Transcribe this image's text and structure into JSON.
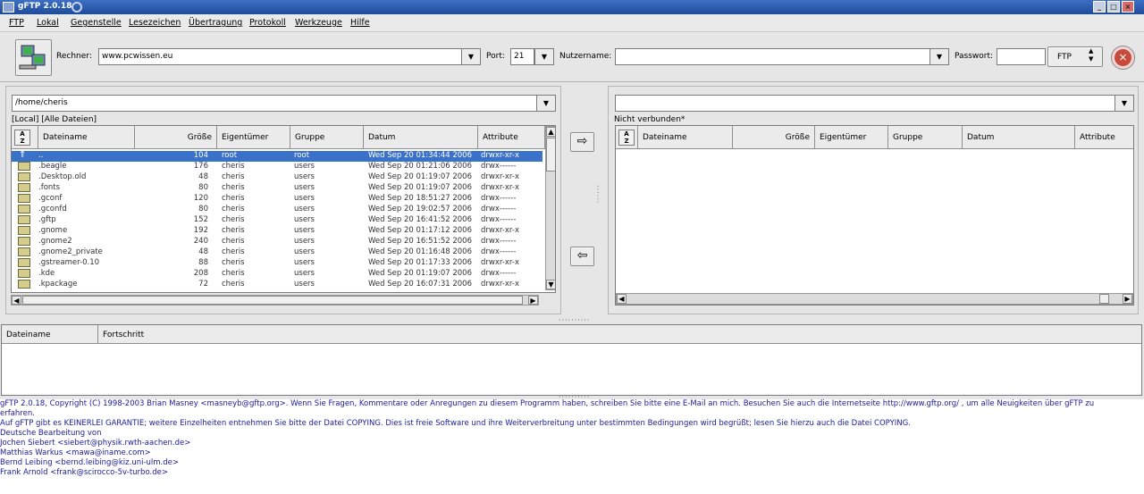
{
  "window": {
    "title": "gFTP 2.0.18"
  },
  "menu": [
    "FTP",
    "Lokal",
    "Gegenstelle",
    "Lesezeichen",
    "Übertragung",
    "Protokoll",
    "Werkzeuge",
    "Hilfe"
  ],
  "toolbar": {
    "host_label": "Rechner:",
    "host_value": "www.pcwissen.eu",
    "port_label": "Port:",
    "port_value": "21",
    "user_label": "Nutzername:",
    "user_value": "",
    "password_label": "Passwort:",
    "password_value": "",
    "protocol_value": "FTP"
  },
  "local": {
    "path": "/home/cheris",
    "status": "[Local] [Alle Dateien]",
    "columns": [
      "Dateiname",
      "Größe",
      "Eigentümer",
      "Gruppe",
      "Datum",
      "Attribute"
    ],
    "files": [
      {
        "name": "..",
        "size": "104",
        "owner": "root",
        "group": "root",
        "date": "Wed Sep 20 01:34:44 2006",
        "attr": "drwxr-xr-x",
        "icon": "up-arrow-icon",
        "selected": true
      },
      {
        "name": ".beagle",
        "size": "176",
        "owner": "cheris",
        "group": "users",
        "date": "Wed Sep 20 01:21:06 2006",
        "attr": "drwx------",
        "icon": "folder-icon"
      },
      {
        "name": ".Desktop.old",
        "size": "48",
        "owner": "cheris",
        "group": "users",
        "date": "Wed Sep 20 01:19:07 2006",
        "attr": "drwxr-xr-x",
        "icon": "folder-icon"
      },
      {
        "name": ".fonts",
        "size": "80",
        "owner": "cheris",
        "group": "users",
        "date": "Wed Sep 20 01:19:07 2006",
        "attr": "drwxr-xr-x",
        "icon": "folder-icon"
      },
      {
        "name": ".gconf",
        "size": "120",
        "owner": "cheris",
        "group": "users",
        "date": "Wed Sep 20 18:51:27 2006",
        "attr": "drwx------",
        "icon": "folder-icon"
      },
      {
        "name": ".gconfd",
        "size": "80",
        "owner": "cheris",
        "group": "users",
        "date": "Wed Sep 20 19:02:57 2006",
        "attr": "drwx------",
        "icon": "folder-icon"
      },
      {
        "name": ".gftp",
        "size": "152",
        "owner": "cheris",
        "group": "users",
        "date": "Wed Sep 20 16:41:52 2006",
        "attr": "drwx------",
        "icon": "folder-icon"
      },
      {
        "name": ".gnome",
        "size": "192",
        "owner": "cheris",
        "group": "users",
        "date": "Wed Sep 20 01:17:12 2006",
        "attr": "drwxr-xr-x",
        "icon": "folder-icon"
      },
      {
        "name": ".gnome2",
        "size": "240",
        "owner": "cheris",
        "group": "users",
        "date": "Wed Sep 20 16:51:52 2006",
        "attr": "drwx------",
        "icon": "folder-icon"
      },
      {
        "name": ".gnome2_private",
        "size": "48",
        "owner": "cheris",
        "group": "users",
        "date": "Wed Sep 20 01:16:48 2006",
        "attr": "drwx------",
        "icon": "folder-icon"
      },
      {
        "name": ".gstreamer-0.10",
        "size": "88",
        "owner": "cheris",
        "group": "users",
        "date": "Wed Sep 20 01:17:33 2006",
        "attr": "drwxr-xr-x",
        "icon": "folder-icon"
      },
      {
        "name": ".kde",
        "size": "208",
        "owner": "cheris",
        "group": "users",
        "date": "Wed Sep 20 01:19:07 2006",
        "attr": "drwx------",
        "icon": "folder-icon"
      },
      {
        "name": ".kpackage",
        "size": "72",
        "owner": "cheris",
        "group": "users",
        "date": "Wed Sep 20 16:07:31 2006",
        "attr": "drwxr-xr-x",
        "icon": "folder-icon"
      }
    ]
  },
  "remote": {
    "path": "",
    "status": "Nicht verbunden*",
    "columns": [
      "Dateiname",
      "Größe",
      "Eigentümer",
      "Gruppe",
      "Datum",
      "Attribute"
    ]
  },
  "transfer": {
    "columns": [
      "Dateiname",
      "Fortschritt"
    ]
  },
  "log": [
    "gFTP 2.0.18, Copyright (C) 1998-2003 Brian Masney <masneyb@gftp.org>. Wenn Sie Fragen, Kommentare oder Anregungen zu diesem Programm haben, schreiben Sie bitte eine E-Mail an mich. Besuchen Sie auch die Internetseite http://www.gftp.org/ , um alle Neuigkeiten über gFTP zu",
    "erfahren.",
    "Auf gFTP gibt es KEINERLEI GARANTIE; weitere Einzelheiten entnehmen Sie bitte der Datei COPYING. Dies ist freie Software und ihre Weiterverbreitung unter bestimmten Bedingungen wird begrüßt; lesen Sie hierzu auch die Datei COPYING.",
    "Deutsche Bearbeitung von",
    "Jochen Siebert <siebert@physik.rwth-aachen.de>",
    "Matthias Warkus <mawa@iname.com>",
    "Bernd Leibing <bernd.leibing@kiz.uni-ulm.de>",
    "Frank Arnold <frank@scirocco-5v-turbo.de>"
  ],
  "colors": {
    "selection": "#3a72c9",
    "log_text": "#1a1a9c",
    "titlebar": "#2a5ab0"
  }
}
